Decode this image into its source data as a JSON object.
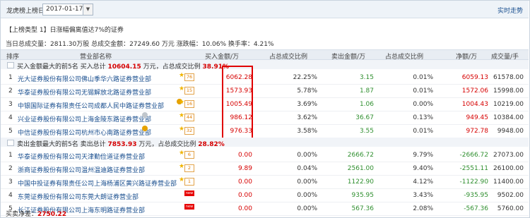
{
  "header": {
    "label": "龙虎榜上榜日",
    "date": "2017-01-17",
    "realtime": "实时走势"
  },
  "listing": {
    "type_line": "【上榜类型 1】日涨幅偏离值达7%的证券",
    "summary_line": "当日总成交量：2811.30万股 总成交金额：27249.60 万元 涨跌幅：10.06% 换手率：4.21%"
  },
  "table": {
    "headers": [
      "排序",
      "营业部名称",
      "买入金额/万",
      "占总成交比例",
      "卖出金额/万",
      "占总成交比例",
      "净额/万",
      "成交量/手"
    ]
  },
  "buy": {
    "title_prefix": "买入金额最大的前5名",
    "title_middle": "买入总计",
    "total": "10604.15",
    "title_suffix": "万元，占总成交比例",
    "ratio": "38.91%",
    "rows": [
      {
        "idx": "1",
        "dept": "光大证券股份有限公司佛山季华六路证券营业部",
        "tag": "76",
        "buy": "6062.28",
        "buy_ratio": "22.25%",
        "sell": "3.15",
        "sell_ratio": "0.01%",
        "net": "6059.13",
        "vol": "61578.00"
      },
      {
        "idx": "2",
        "dept": "华泰证券股份有限公司无锡解放北路证券营业部",
        "tag": "15",
        "buy": "1573.93",
        "buy_ratio": "5.78%",
        "sell": "1.87",
        "sell_ratio": "0.01%",
        "net": "1572.06",
        "vol": "15998.00"
      },
      {
        "idx": "3",
        "dept": "中银国际证券有限责任公司成都人民中路证券营业部",
        "tag": "16",
        "buy": "1005.49",
        "buy_ratio": "3.69%",
        "sell": "1.06",
        "sell_ratio": "0.00%",
        "net": "1004.43",
        "vol": "10219.00"
      },
      {
        "idx": "4",
        "dept": "兴业证券股份有限公司上海金陵东路证券营业部",
        "tag": "44",
        "buy": "986.12",
        "buy_ratio": "3.62%",
        "sell": "36.67",
        "sell_ratio": "0.13%",
        "net": "949.45",
        "vol": "10384.00"
      },
      {
        "idx": "5",
        "dept": "中信证券股份有限公司杭州市心南路证券营业部",
        "tag": "32",
        "buy": "976.33",
        "buy_ratio": "3.58%",
        "sell": "3.55",
        "sell_ratio": "0.01%",
        "net": "972.78",
        "vol": "9948.00"
      }
    ]
  },
  "sell": {
    "title_prefix": "卖出金额最大的前5名",
    "title_middle": "卖出总计",
    "total": "7853.93",
    "title_suffix": "万元，占总成交比例",
    "ratio": "28.82%",
    "rows": [
      {
        "idx": "1",
        "dept": "华泰证券股份有限公司天津勤俭道证券营业部",
        "tag": "6",
        "buy": "0.00",
        "buy_ratio": "0.00%",
        "sell": "2666.72",
        "sell_ratio": "9.79%",
        "net": "-2666.72",
        "vol": "27073.00"
      },
      {
        "idx": "2",
        "dept": "浙商证券股份有限公司温州温迪路证券营业部",
        "tag": "2",
        "buy": "9.89",
        "buy_ratio": "0.04%",
        "sell": "2561.00",
        "sell_ratio": "9.40%",
        "net": "-2551.11",
        "vol": "26100.00"
      },
      {
        "idx": "3",
        "dept": "中国中投证券有限责任公司上海杨浦区黄兴路证券营业部",
        "tag": "1",
        "buy": "0.00",
        "buy_ratio": "0.00%",
        "sell": "1122.90",
        "sell_ratio": "4.12%",
        "net": "-1122.90",
        "vol": "11400.00"
      },
      {
        "idx": "4",
        "dept": "东莞证券股份有限公司东莞大朗证券营业部",
        "tag": "new",
        "buy": "0.00",
        "buy_ratio": "0.00%",
        "sell": "935.95",
        "sell_ratio": "3.43%",
        "net": "-935.95",
        "vol": "9502.00"
      },
      {
        "idx": "5",
        "dept": "长江证券股份有限公司上海东明路证券营业部",
        "tag": "new",
        "buy": "0.00",
        "buy_ratio": "0.00%",
        "sell": "567.36",
        "sell_ratio": "2.08%",
        "net": "-567.36",
        "vol": "5760.00"
      }
    ]
  },
  "net": {
    "label": "买卖净差：",
    "value": "2750.22"
  }
}
